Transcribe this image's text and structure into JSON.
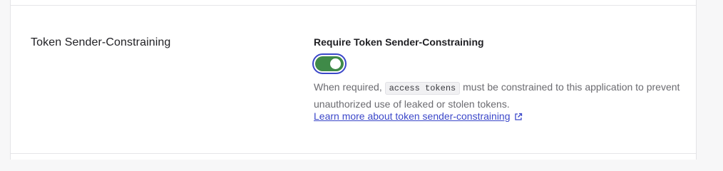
{
  "section": {
    "title": "Token Sender-Constraining"
  },
  "field": {
    "label": "Require Token Sender-Constraining",
    "toggle_on": true,
    "description_before": "When required, ",
    "code": "access tokens",
    "description_after": " must be constrained to this application to prevent unauthorized use of leaked or stolen tokens.",
    "link_text": "Learn more about token sender-constraining",
    "link_icon": "external-link-icon"
  },
  "colors": {
    "toggle_on": "#3f8a48",
    "focus_ring": "#3b47c9",
    "link": "#3b47c9"
  }
}
